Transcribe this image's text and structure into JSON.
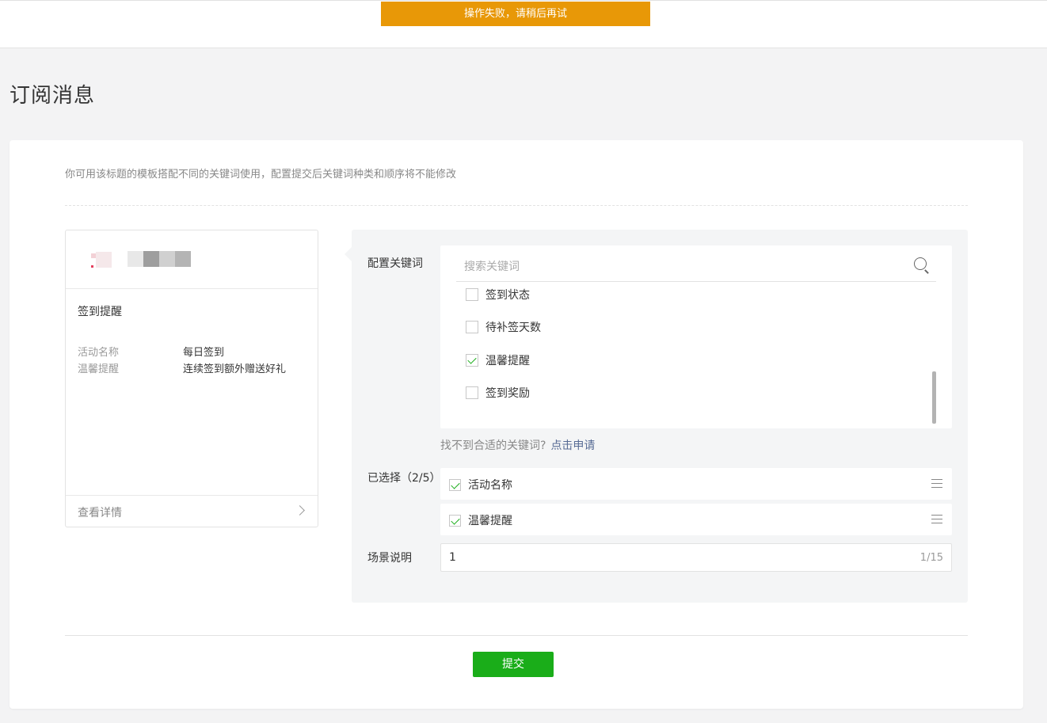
{
  "toast": {
    "message": "操作失败，请稍后再试",
    "color": "#e89807"
  },
  "page": {
    "title": "订阅消息"
  },
  "tip": "你可用该标题的模板搭配不同的关键词使用，配置提交后关键词种类和顺序将不能修改",
  "preview": {
    "title": "签到提醒",
    "rows": [
      {
        "key": "活动名称",
        "value": "每日签到"
      },
      {
        "key": "温馨提醒",
        "value": "连续签到额外赠送好礼"
      }
    ],
    "footer_label": "查看详情",
    "icons": {
      "footer": "chevron-right-icon"
    }
  },
  "config": {
    "keywords_label": "配置关键词",
    "search_placeholder": "搜索关键词",
    "keyword_options": [
      {
        "label": "签到状态",
        "checked": false
      },
      {
        "label": "待补签天数",
        "checked": false
      },
      {
        "label": "温馨提醒",
        "checked": true
      },
      {
        "label": "签到奖励",
        "checked": false
      }
    ],
    "hint_text": "找不到合适的关键词?",
    "hint_link": "点击申请",
    "selected_label": "已选择（2/5）",
    "selected": [
      {
        "label": "活动名称"
      },
      {
        "label": "温馨提醒"
      }
    ],
    "scene_label": "场景说明",
    "scene_value": "1",
    "scene_count": "1/15"
  },
  "actions": {
    "submit_label": "提交"
  },
  "colors": {
    "accent": "#1aad19",
    "link": "#576b95"
  }
}
